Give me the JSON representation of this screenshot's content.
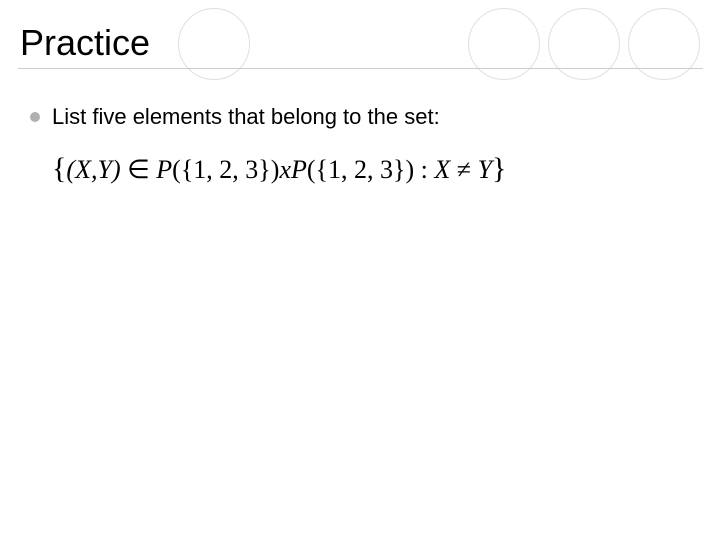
{
  "slide": {
    "title": "Practice",
    "bullet_text": "List five elements that belong to the set:",
    "formula": "{(X,Y) ∈ P({1,2,3}) x P({1,2,3}) : X ≠ Y}"
  }
}
